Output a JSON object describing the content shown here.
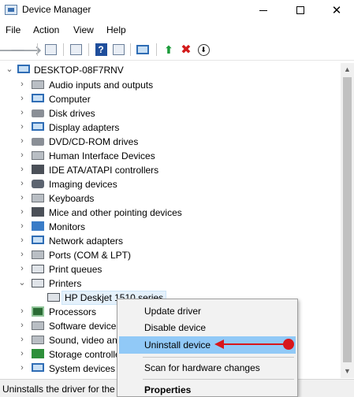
{
  "window": {
    "title": "Device Manager",
    "close_glyph": "✕"
  },
  "menu": [
    {
      "label": "File"
    },
    {
      "label": "Action"
    },
    {
      "label": "View"
    },
    {
      "label": "Help"
    }
  ],
  "toolbar": {
    "back": "🡐",
    "forward": "🡒",
    "help": "?",
    "enable": "⬆",
    "uninstall": "✖",
    "update": "⬇"
  },
  "tree": {
    "root": "DESKTOP-08F7RNV",
    "expanded_glyph": "⌄",
    "collapsed_glyph": "›",
    "categories": [
      {
        "label": "Audio inputs and outputs",
        "icon": "speaker-icon"
      },
      {
        "label": "Computer",
        "icon": "computer-icon"
      },
      {
        "label": "Disk drives",
        "icon": "disk-drive-icon"
      },
      {
        "label": "Display adapters",
        "icon": "display-adapter-icon"
      },
      {
        "label": "DVD/CD-ROM drives",
        "icon": "dvd-drive-icon"
      },
      {
        "label": "Human Interface Devices",
        "icon": "hid-icon"
      },
      {
        "label": "IDE ATA/ATAPI controllers",
        "icon": "ide-controller-icon"
      },
      {
        "label": "Imaging devices",
        "icon": "camera-icon"
      },
      {
        "label": "Keyboards",
        "icon": "keyboard-icon"
      },
      {
        "label": "Mice and other pointing devices",
        "icon": "mouse-icon"
      },
      {
        "label": "Monitors",
        "icon": "monitor-icon"
      },
      {
        "label": "Network adapters",
        "icon": "network-adapter-icon"
      },
      {
        "label": "Ports (COM & LPT)",
        "icon": "port-icon"
      },
      {
        "label": "Print queues",
        "icon": "print-queue-icon"
      },
      {
        "label": "Printers",
        "icon": "printer-icon"
      },
      {
        "label": "HP Deskjet 1510 series",
        "icon": "printer-icon"
      },
      {
        "label": "Processors",
        "icon": "processor-icon"
      },
      {
        "label": "Software devices",
        "icon": "software-device-icon"
      },
      {
        "label": "Sound, video and game controllers",
        "icon": "sound-icon"
      },
      {
        "label": "Storage controllers",
        "icon": "storage-controller-icon"
      },
      {
        "label": "System devices",
        "icon": "system-device-icon"
      }
    ]
  },
  "context_menu": {
    "update_driver": "Update driver",
    "disable_device": "Disable device",
    "uninstall_device": "Uninstall device",
    "scan": "Scan for hardware changes",
    "properties": "Properties"
  },
  "status": {
    "text": "Uninstalls the driver for the selected device."
  },
  "colors": {
    "highlight": "#91c9f7",
    "annotation_arrow": "#d8161b",
    "selection": "#e5f1fb"
  }
}
